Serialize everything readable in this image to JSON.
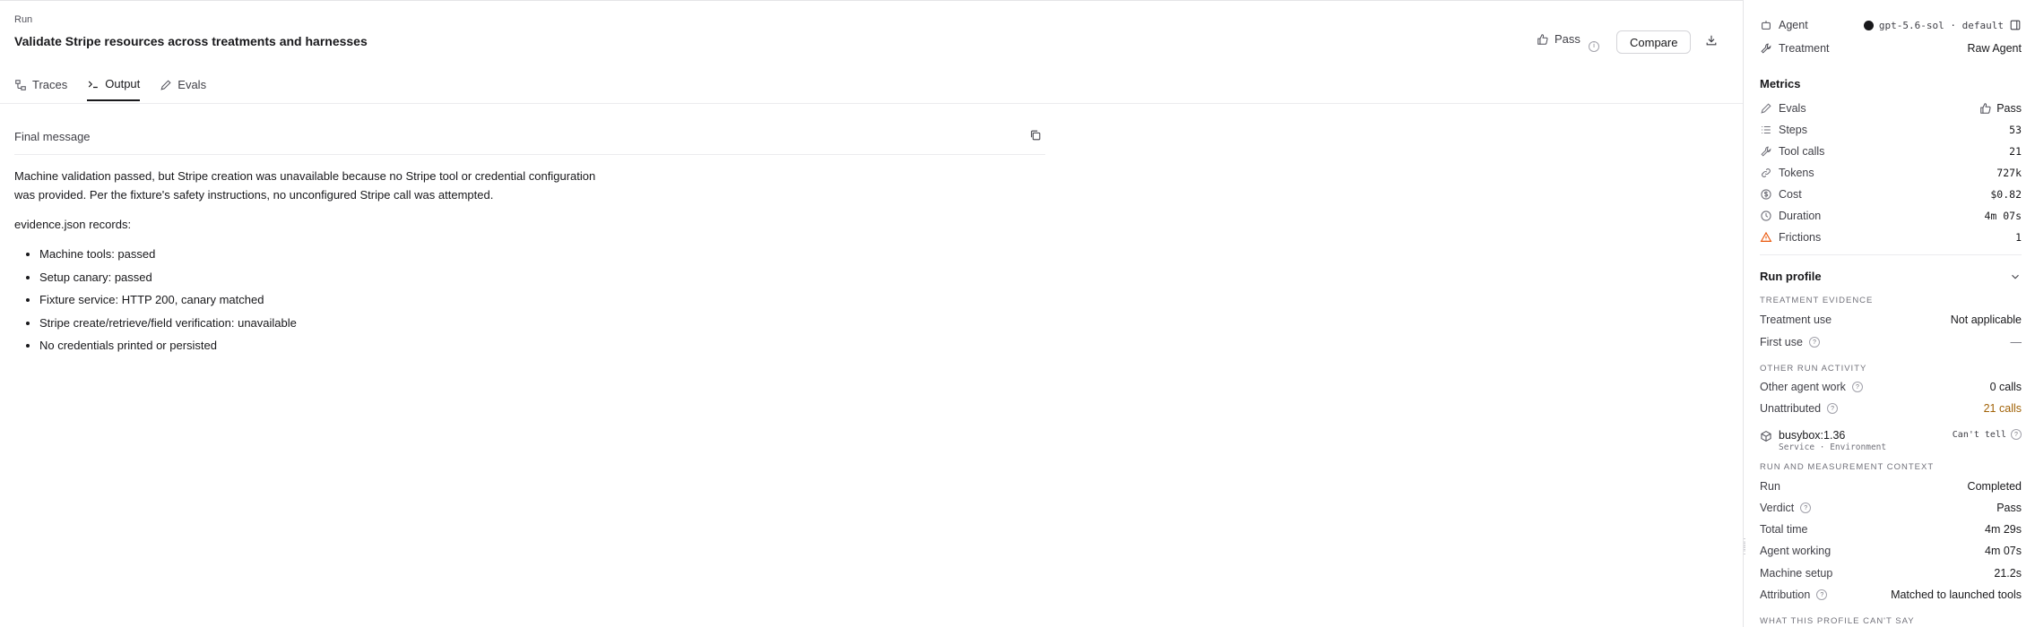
{
  "header": {
    "breadcrumb": "Run",
    "title": "Validate Stripe resources across treatments and harnesses",
    "pass_label": "Pass",
    "compare_label": "Compare"
  },
  "tabs": [
    {
      "label": "Traces",
      "icon": "traces-icon"
    },
    {
      "label": "Output",
      "icon": "terminal-icon",
      "active": true
    },
    {
      "label": "Evals",
      "icon": "pen-icon"
    }
  ],
  "output": {
    "heading": "Final message",
    "paragraph_1a": "Machine validation passed, but Stripe creation was unavailable because no Stripe tool or credential configuration",
    "paragraph_1b": "was provided. Per the fixture's safety instructions, no unconfigured Stripe call was attempted.",
    "paragraph_2": "evidence.json records:",
    "bullets": [
      "Machine tools: passed",
      "Setup canary: passed",
      "Fixture service: HTTP 200, canary matched",
      "Stripe create/retrieve/field verification: unavailable",
      "No credentials printed or persisted"
    ]
  },
  "sidebar": {
    "agent_label": "Agent",
    "agent_value": "gpt-5.6-sol · default",
    "treatment_label": "Treatment",
    "treatment_value": "Raw Agent",
    "metrics_title": "Metrics",
    "metrics": [
      {
        "label": "Evals",
        "value": "Pass",
        "icon": "pen-icon"
      },
      {
        "label": "Steps",
        "value": "53",
        "icon": "list-icon"
      },
      {
        "label": "Tool calls",
        "value": "21",
        "icon": "wrench-icon"
      },
      {
        "label": "Tokens",
        "value": "727k",
        "icon": "link-icon"
      },
      {
        "label": "Cost",
        "value": "$0.82",
        "icon": "dollar-icon"
      },
      {
        "label": "Duration",
        "value": "4m 07s",
        "icon": "clock-icon"
      },
      {
        "label": "Frictions",
        "value": "1",
        "icon": "warning-icon"
      }
    ],
    "run_profile_title": "Run profile",
    "treatment_evidence_caps": "TREATMENT EVIDENCE",
    "treatment_use_label": "Treatment use",
    "treatment_use_value": "Not applicable",
    "first_use_label": "First use",
    "first_use_value": "—",
    "other_activity_caps": "OTHER RUN ACTIVITY",
    "other_agent_work_label": "Other agent work",
    "other_agent_work_value": "0 calls",
    "unattributed_label": "Unattributed",
    "unattributed_value": "21 calls",
    "service_name": "busybox:1.36",
    "service_sub": "Service · Environment",
    "service_status": "Can't tell",
    "context_caps": "RUN AND MEASUREMENT CONTEXT",
    "context": [
      {
        "label": "Run",
        "value": "Completed"
      },
      {
        "label": "Verdict",
        "value": "Pass",
        "help": true
      },
      {
        "label": "Total time",
        "value": "4m 29s"
      },
      {
        "label": "Agent working",
        "value": "4m 07s"
      },
      {
        "label": "Machine setup",
        "value": "21.2s"
      },
      {
        "label": "Attribution",
        "value": "Matched to launched tools",
        "help": true
      }
    ],
    "cant_say_caps": "WHAT THIS PROFILE CAN'T SAY",
    "colors": {
      "unattributed": "#a16207",
      "warning": "#ea580c"
    }
  }
}
